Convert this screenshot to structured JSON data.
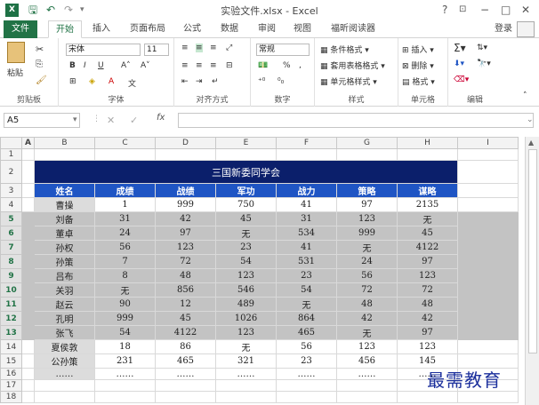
{
  "window": {
    "title": "实验文件.xlsx - Excel",
    "app_icon": "X",
    "help": "?",
    "controls": [
      "−",
      "□",
      "✕"
    ]
  },
  "ribbon_tabs": [
    "文件",
    "开始",
    "插入",
    "页面布局",
    "公式",
    "数据",
    "审阅",
    "视图",
    "福昕阅读器"
  ],
  "active_tab": "开始",
  "login": "登录",
  "groups": {
    "clipboard": {
      "label": "剪贴板",
      "paste": "粘贴"
    },
    "font": {
      "label": "字体",
      "name": "宋体",
      "size": "11"
    },
    "alignment": {
      "label": "对齐方式"
    },
    "number": {
      "label": "数字",
      "format": "常规",
      "percent": "%"
    },
    "styles": {
      "label": "样式",
      "items": [
        "条件格式",
        "套用表格格式",
        "单元格样式"
      ]
    },
    "cells": {
      "label": "单元格",
      "items": [
        "插入",
        "删除",
        "格式"
      ]
    },
    "editing": {
      "label": "编辑"
    }
  },
  "formula_bar": {
    "name_box": "A5",
    "fx": "fx",
    "value": ""
  },
  "columns": [
    "A",
    "B",
    "C",
    "D",
    "E",
    "F",
    "G",
    "H",
    "I"
  ],
  "sheet": {
    "title": "三国新委同学会",
    "headers": [
      "姓名",
      "成绩",
      "战绩",
      "军功",
      "战力",
      "策略",
      "谋略"
    ],
    "rows": [
      [
        "曹操",
        "1",
        "999",
        "750",
        "41",
        "97",
        "2135"
      ],
      [
        "刘备",
        "31",
        "42",
        "45",
        "31",
        "123",
        "无"
      ],
      [
        "董卓",
        "24",
        "97",
        "无",
        "534",
        "999",
        "45"
      ],
      [
        "孙权",
        "56",
        "123",
        "23",
        "41",
        "无",
        "4122"
      ],
      [
        "孙策",
        "7",
        "72",
        "54",
        "531",
        "24",
        "97"
      ],
      [
        "吕布",
        "8",
        "48",
        "123",
        "23",
        "56",
        "123"
      ],
      [
        "关羽",
        "无",
        "856",
        "546",
        "54",
        "72",
        "72"
      ],
      [
        "赵云",
        "90",
        "12",
        "489",
        "无",
        "48",
        "48"
      ],
      [
        "孔明",
        "999",
        "45",
        "1026",
        "864",
        "42",
        "42"
      ],
      [
        "张飞",
        "54",
        "4122",
        "123",
        "465",
        "无",
        "97"
      ],
      [
        "夏侯敦",
        "18",
        "86",
        "无",
        "56",
        "123",
        "123"
      ],
      [
        "公孙策",
        "231",
        "465",
        "321",
        "23",
        "456",
        "145"
      ],
      [
        "……",
        "……",
        "……",
        "……",
        "……",
        "……",
        "……"
      ]
    ]
  },
  "watermark": "最需教育"
}
